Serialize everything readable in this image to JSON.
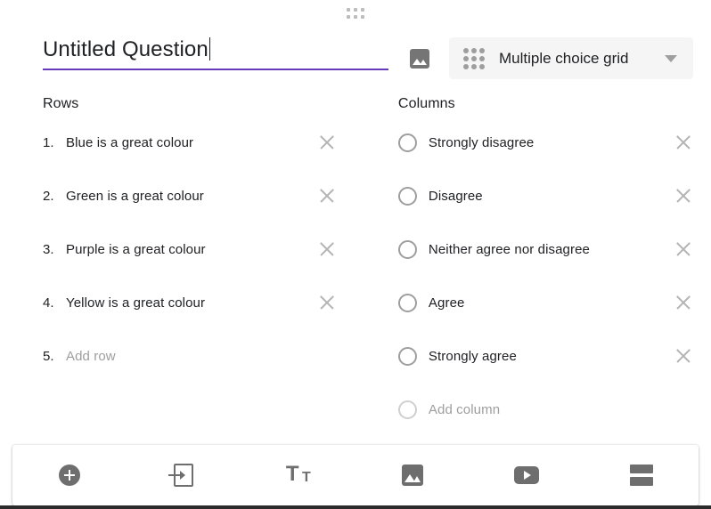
{
  "question": {
    "title": "Untitled Question",
    "type_label": "Multiple choice grid",
    "accent_color": "#673ab7",
    "image_icon": "image-icon",
    "grid_icon": "grid-9-dots-icon",
    "chevron_icon": "chevron-down-icon",
    "drag_handle_icon": "drag-handle-dots-icon"
  },
  "rows_pane": {
    "heading": "Rows",
    "items": [
      {
        "num": "1.",
        "text": "Blue is a great colour",
        "placeholder": false,
        "delete_icon": "close-icon"
      },
      {
        "num": "2.",
        "text": "Green is a great colour",
        "placeholder": false,
        "delete_icon": "close-icon"
      },
      {
        "num": "3.",
        "text": "Purple is a great colour",
        "placeholder": false,
        "delete_icon": "close-icon"
      },
      {
        "num": "4.",
        "text": "Yellow is a great colour",
        "placeholder": false,
        "delete_icon": "close-icon"
      },
      {
        "num": "5.",
        "text": "Add row",
        "placeholder": true,
        "delete_icon": null
      }
    ]
  },
  "columns_pane": {
    "heading": "Columns",
    "items": [
      {
        "text": "Strongly disagree",
        "placeholder": false,
        "radio_icon": "radio-unselected-icon",
        "delete_icon": "close-icon"
      },
      {
        "text": "Disagree",
        "placeholder": false,
        "radio_icon": "radio-unselected-icon",
        "delete_icon": "close-icon"
      },
      {
        "text": "Neither agree nor disagree",
        "placeholder": false,
        "radio_icon": "radio-unselected-icon",
        "delete_icon": "close-icon"
      },
      {
        "text": "Agree",
        "placeholder": false,
        "radio_icon": "radio-unselected-icon",
        "delete_icon": "close-icon"
      },
      {
        "text": "Strongly agree",
        "placeholder": false,
        "radio_icon": "radio-unselected-icon",
        "delete_icon": "close-icon"
      },
      {
        "text": "Add column",
        "placeholder": true,
        "radio_icon": "radio-unselected-icon",
        "delete_icon": null
      }
    ]
  },
  "toolbar": {
    "buttons": [
      {
        "name": "add-question-button",
        "icon": "add-circle-icon"
      },
      {
        "name": "import-questions-button",
        "icon": "import-document-icon"
      },
      {
        "name": "add-title-description-button",
        "icon": "title-text-icon"
      },
      {
        "name": "add-image-button",
        "icon": "image-icon"
      },
      {
        "name": "add-video-button",
        "icon": "video-play-icon"
      },
      {
        "name": "add-section-button",
        "icon": "section-split-icon"
      }
    ],
    "title_icon_big": "T",
    "title_icon_small": "T"
  }
}
